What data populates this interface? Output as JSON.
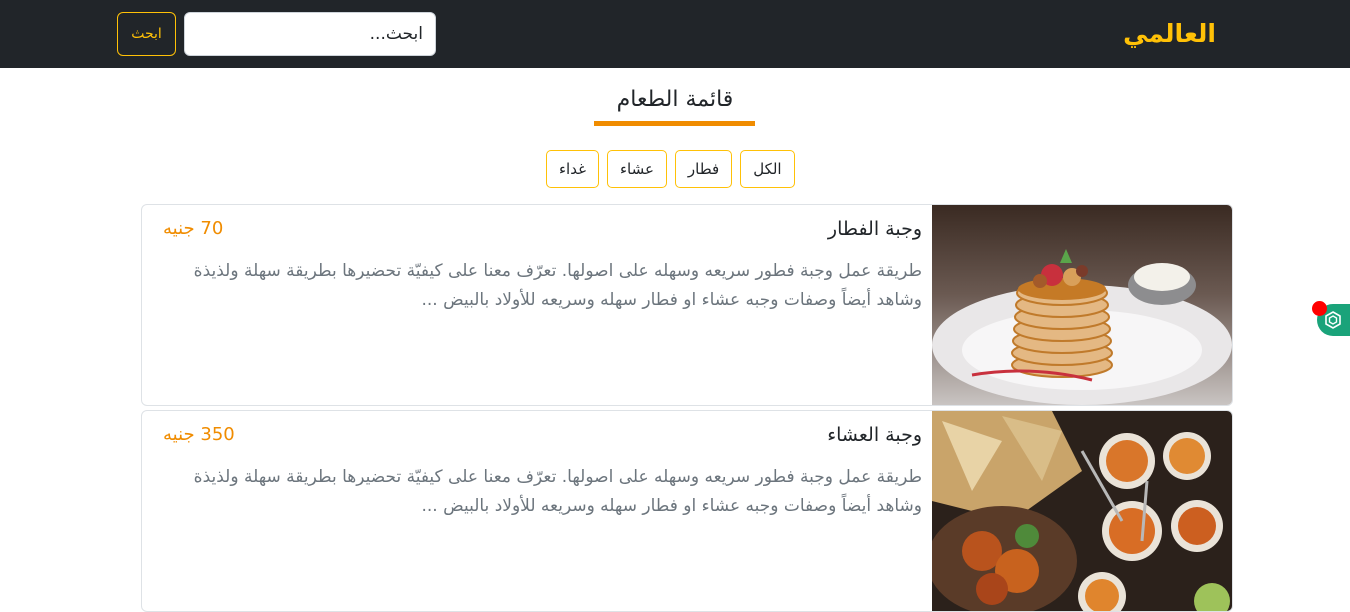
{
  "navbar": {
    "brand": "العالمي",
    "search_placeholder": "ابحث...",
    "search_button": "ابحث"
  },
  "menu": {
    "title": "قائمة الطعام",
    "filters": [
      "الكل",
      "فطار",
      "عشاء",
      "غداء"
    ]
  },
  "items": [
    {
      "title": "وجبة الفطار",
      "price": "70 جنيه",
      "description": "طريقة عمل وجبة فطور سريعه وسهله على اصولها. تعرّف معنا على كيفيّة تحضيرها بطريقة سهلة ولذيذة وشاهد أيضاً وصفات وجبه عشاء او فطار سهله وسريعه للأولاد بالبيض ...",
      "image": "pancakes-photo"
    },
    {
      "title": "وجبة العشاء",
      "price": "350 جنيه",
      "description": "طريقة عمل وجبة فطور سريعه وسهله على اصولها. تعرّف معنا على كيفيّة تحضيرها بطريقة سهلة ولذيذة وشاهد أيضاً وصفات وجبه عشاء او فطار سهله وسريعه للأولاد بالبيض ...",
      "image": "indian-dinner-photo"
    }
  ],
  "colors": {
    "navbar_bg": "#212529",
    "brand": "#ffc107",
    "accent": "#f08c00",
    "widget": "#1aa37a"
  },
  "icons": {
    "side_widget": "hexagon-gear-icon"
  }
}
